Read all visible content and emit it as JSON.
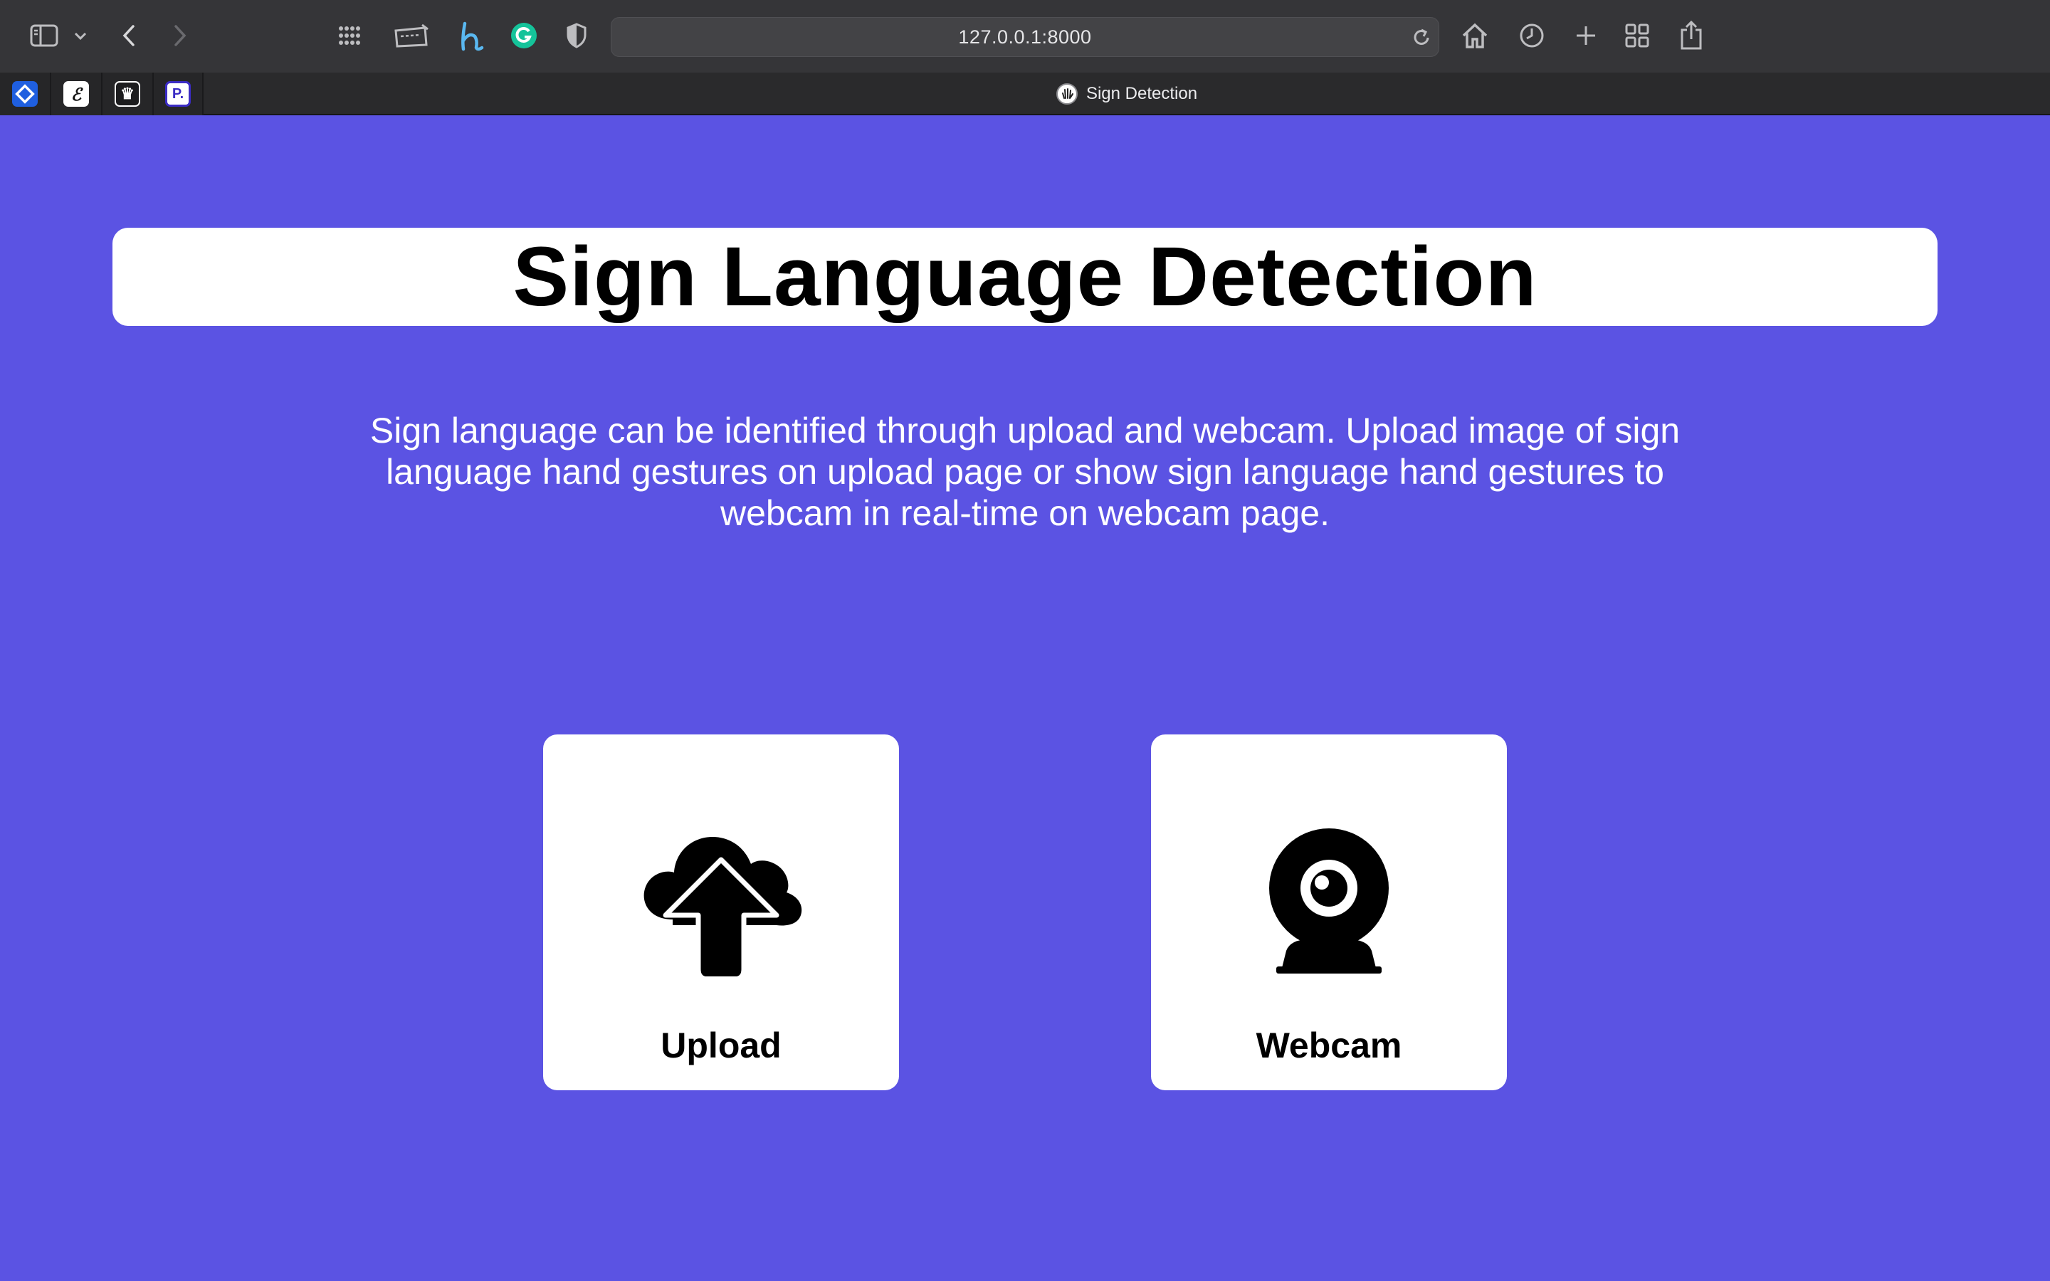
{
  "browser": {
    "url": "127.0.0.1:8000",
    "active_tab_title": "Sign Detection",
    "pinned_tabs": [
      {
        "name": "pinned-tab-1",
        "icon": "diamond-icon"
      },
      {
        "name": "pinned-tab-2",
        "icon": "letter-e-icon",
        "glyph": "ℰ"
      },
      {
        "name": "pinned-tab-3",
        "icon": "crown-icon",
        "glyph": "♛"
      },
      {
        "name": "pinned-tab-4",
        "icon": "letter-p-icon",
        "glyph": "P."
      }
    ],
    "toolbar_icons": [
      "sidebar-icon",
      "chevron-down-icon",
      "back-icon",
      "forward-icon",
      "grid-dots-icon",
      "keyboard-icon",
      "h-extension-icon",
      "grammarly-icon",
      "shield-icon",
      "reload-icon",
      "home-icon",
      "history-icon",
      "new-tab-icon",
      "tab-overview-icon",
      "share-icon"
    ]
  },
  "page": {
    "title": "Sign Language Detection",
    "description": "Sign language can be identified through upload and webcam. Upload image of sign language hand gestures on upload page or show sign language hand gestures to webcam in real-time on webcam page.",
    "cards": [
      {
        "label": "Upload",
        "icon": "cloud-upload-icon"
      },
      {
        "label": "Webcam",
        "icon": "webcam-icon"
      }
    ]
  },
  "colors": {
    "background": "#5b53e3",
    "card": "#ffffff",
    "toolbar": "#353538",
    "tabbar": "#2a2a2c",
    "grammarly": "#15c39a"
  }
}
